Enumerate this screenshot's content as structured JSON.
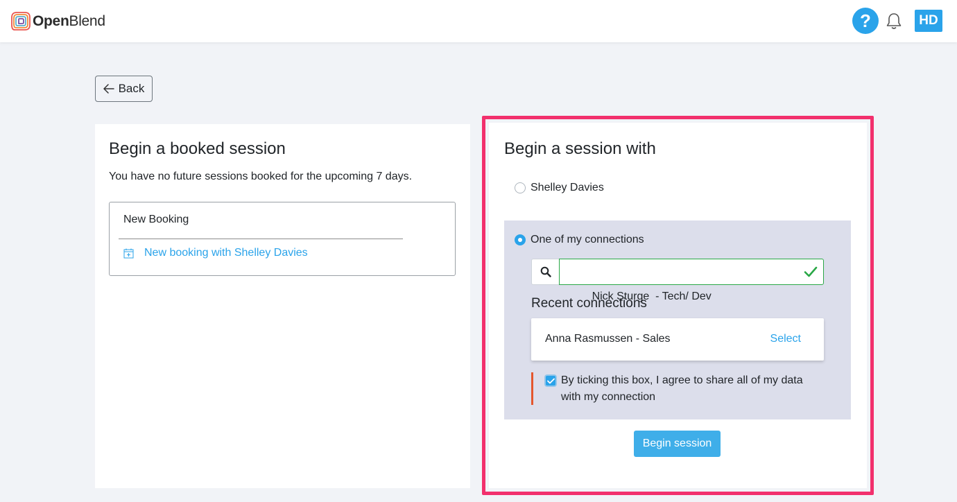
{
  "header": {
    "logo_text_bold": "Open",
    "logo_text_rest": "Blend",
    "help_label": "?",
    "avatar_initials": "HD"
  },
  "back_label": "Back",
  "booked_session": {
    "title": "Begin a booked session",
    "message": "You have no future sessions booked for the upcoming 7 days.",
    "new_booking_title": "New Booking",
    "new_booking_link": "New booking with Shelley Davies"
  },
  "session_with": {
    "title": "Begin a session with",
    "option_manager": "Shelley Davies",
    "option_connections": "One of my connections",
    "selected_option": "One of my connections",
    "search_value": "Nick Sturge  - Tech/ Dev",
    "recent_title": "Recent connections",
    "recent": [
      {
        "name": "Anna Rasmussen - Sales",
        "action": "Select"
      }
    ],
    "consent_text": "By ticking this box, I agree to share all of my data with my connection",
    "consent_checked": true,
    "begin_label": "Begin session"
  },
  "colors": {
    "accent": "#2aa3ea",
    "highlight_border": "#f2306d",
    "panel_bg": "#dcdeeb",
    "valid_green": "#28a745"
  }
}
